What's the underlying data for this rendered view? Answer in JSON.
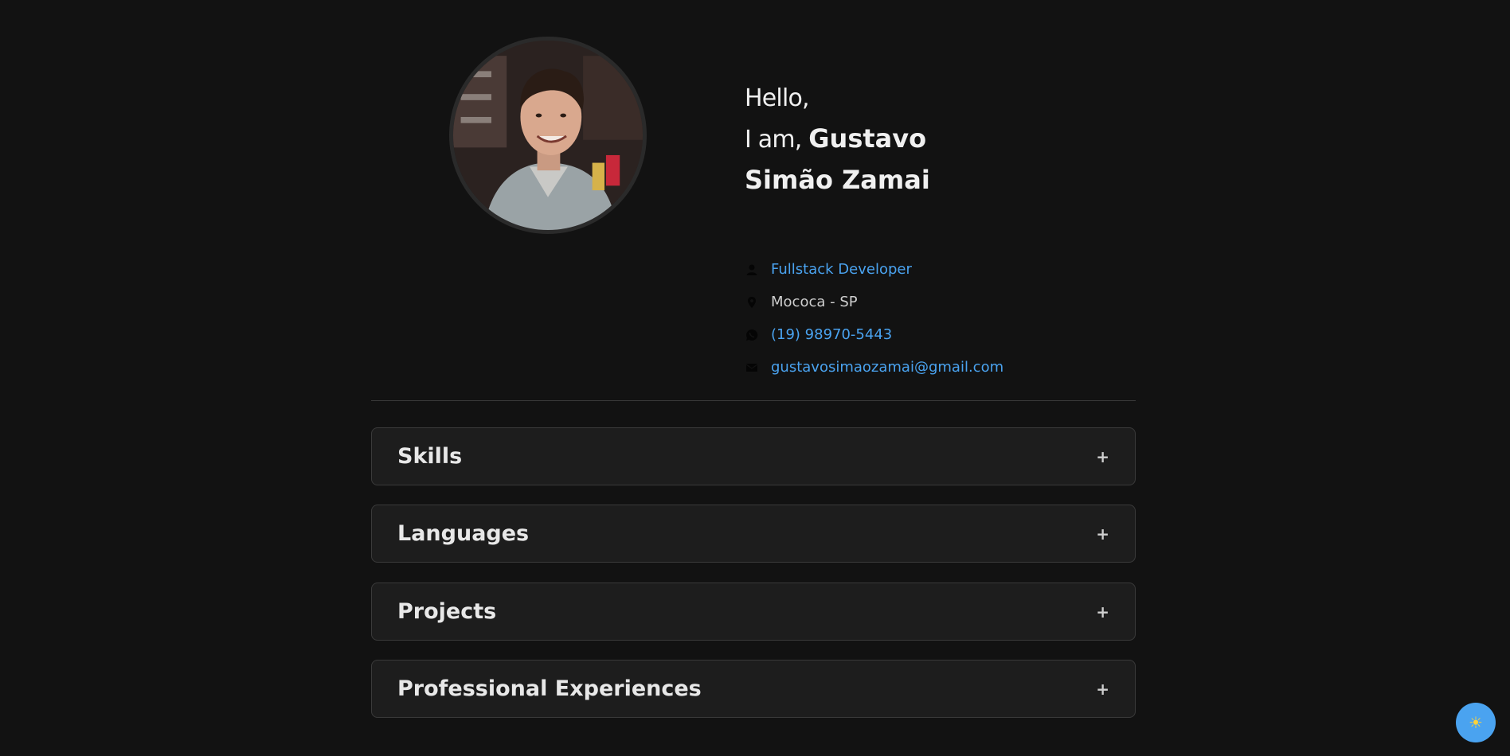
{
  "profile": {
    "greeting_line1": "Hello,",
    "greeting_prefix": "I am,",
    "name_first": "Gustavo",
    "name_rest": "Simão Zamai",
    "avatar_icon": "profile-photo"
  },
  "info": {
    "role": {
      "icon": "person-icon",
      "text": "Fullstack Developer"
    },
    "location": {
      "icon": "map-pin-icon",
      "text": "Mococa - SP"
    },
    "phone": {
      "icon": "whatsapp-icon",
      "text": "(19) 98970-5443"
    },
    "email": {
      "icon": "mail-icon",
      "text": "gustavosimaozamai@gmail.com"
    }
  },
  "sections": [
    {
      "title": "Skills",
      "toggle": "+"
    },
    {
      "title": "Languages",
      "toggle": "+"
    },
    {
      "title": "Projects",
      "toggle": "+"
    },
    {
      "title": "Professional Experiences",
      "toggle": "+"
    }
  ],
  "theme_toggle": {
    "icon": "sun-icon",
    "glyph": "☀"
  },
  "colors": {
    "background": "#121212",
    "card": "#1d1d1d",
    "accent": "#4aa3f0",
    "text": "#e6e6e6"
  }
}
